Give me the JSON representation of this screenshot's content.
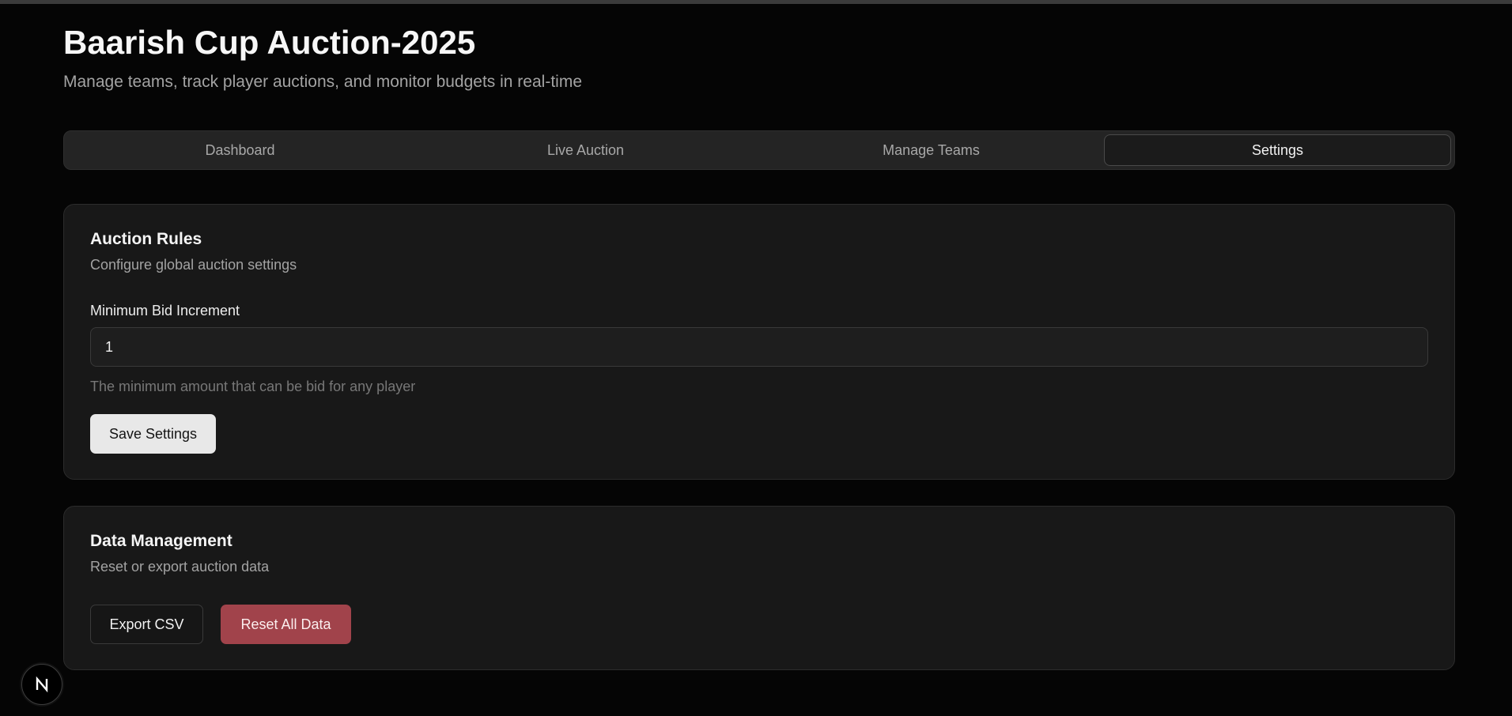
{
  "header": {
    "title": "Baarish Cup Auction-2025",
    "subtitle": "Manage teams, track player auctions, and monitor budgets in real-time"
  },
  "tabs": [
    {
      "label": "Dashboard",
      "active": false
    },
    {
      "label": "Live Auction",
      "active": false
    },
    {
      "label": "Manage Teams",
      "active": false
    },
    {
      "label": "Settings",
      "active": true
    }
  ],
  "auction_rules": {
    "title": "Auction Rules",
    "description": "Configure global auction settings",
    "min_bid_label": "Minimum Bid Increment",
    "min_bid_value": "1",
    "min_bid_help": "The minimum amount that can be bid for any player",
    "save_label": "Save Settings"
  },
  "data_management": {
    "title": "Data Management",
    "description": "Reset or export auction data",
    "export_label": "Export CSV",
    "reset_label": "Reset All Data"
  },
  "dev_badge": {
    "icon": "nextjs-logo-icon"
  },
  "colors": {
    "background": "#050505",
    "card": "#181818",
    "danger": "#a1434b",
    "primary_button": "#e8e8e8"
  }
}
